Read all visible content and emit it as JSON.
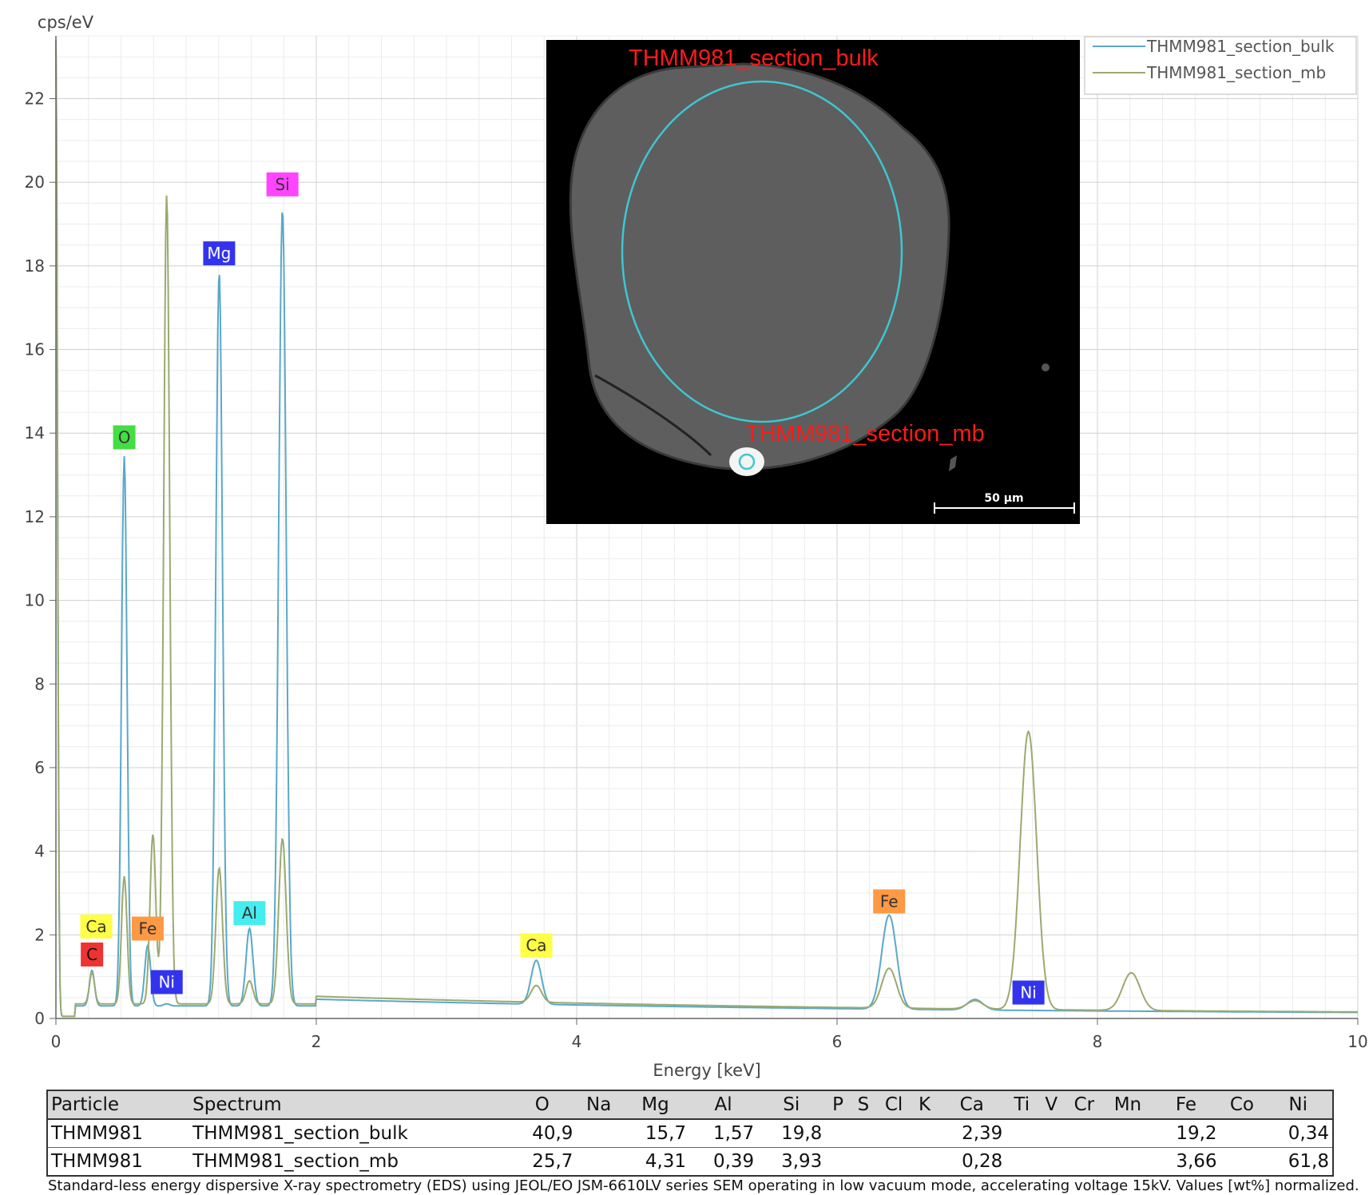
{
  "chart_data": {
    "type": "line",
    "ylabel": "cps/eV",
    "xlabel": "Energy [keV]",
    "xlim": [
      0,
      10
    ],
    "ylim": [
      0,
      23.5
    ],
    "xticks": [
      0,
      2,
      4,
      6,
      8,
      10
    ],
    "yticks": [
      0,
      2,
      4,
      6,
      8,
      10,
      12,
      14,
      16,
      18,
      20,
      22
    ],
    "grid": true,
    "legend_position": "top-right",
    "series": [
      {
        "name": "THMM981_section_bulk",
        "color": "#5aa8c8",
        "peaks": [
          {
            "x": 0.0,
            "y": 23.5
          },
          {
            "x": 0.277,
            "y": 1.0
          },
          {
            "x": 0.525,
            "y": 13.3
          },
          {
            "x": 0.705,
            "y": 1.6
          },
          {
            "x": 0.851,
            "y": 0.2
          },
          {
            "x": 1.254,
            "y": 17.7
          },
          {
            "x": 1.487,
            "y": 2.0
          },
          {
            "x": 1.74,
            "y": 19.2
          },
          {
            "x": 3.69,
            "y": 1.2
          },
          {
            "x": 6.4,
            "y": 2.4
          },
          {
            "x": 7.06,
            "y": 0.4
          },
          {
            "x": 7.47,
            "y": 0.15
          }
        ]
      },
      {
        "name": "THMM981_section_mb",
        "color": "#9aaa70",
        "peaks": [
          {
            "x": 0.0,
            "y": 23.5
          },
          {
            "x": 0.277,
            "y": 0.9
          },
          {
            "x": 0.525,
            "y": 3.2
          },
          {
            "x": 0.745,
            "y": 4.2
          },
          {
            "x": 0.851,
            "y": 19.5
          },
          {
            "x": 1.254,
            "y": 3.4
          },
          {
            "x": 1.487,
            "y": 0.7
          },
          {
            "x": 1.74,
            "y": 4.1
          },
          {
            "x": 3.69,
            "y": 0.55
          },
          {
            "x": 6.4,
            "y": 1.1
          },
          {
            "x": 7.06,
            "y": 0.35
          },
          {
            "x": 7.47,
            "y": 6.8
          },
          {
            "x": 8.26,
            "y": 1.05
          }
        ]
      }
    ],
    "element_labels": [
      {
        "text": "C",
        "x": 0.277,
        "y": 1.53,
        "bg": "#ee3333",
        "fg": "#111111"
      },
      {
        "text": "Ca",
        "x": 0.31,
        "y": 2.2,
        "bg": "#ffff44",
        "fg": "#333333"
      },
      {
        "text": "O",
        "x": 0.525,
        "y": 13.9,
        "bg": "#44dd44",
        "fg": "#333333"
      },
      {
        "text": "Fe",
        "x": 0.705,
        "y": 2.15,
        "bg": "#ff9944",
        "fg": "#333333"
      },
      {
        "text": "Ni",
        "x": 0.851,
        "y": 0.87,
        "bg": "#3333ee",
        "fg": "#ffffff"
      },
      {
        "text": "Mg",
        "x": 1.254,
        "y": 18.3,
        "bg": "#3333ee",
        "fg": "#ffffff"
      },
      {
        "text": "Al",
        "x": 1.487,
        "y": 2.52,
        "bg": "#44eeee",
        "fg": "#333333"
      },
      {
        "text": "Si",
        "x": 1.74,
        "y": 19.95,
        "bg": "#ff44ff",
        "fg": "#333333"
      },
      {
        "text": "Ca",
        "x": 3.69,
        "y": 1.75,
        "bg": "#ffff44",
        "fg": "#333333"
      },
      {
        "text": "Fe",
        "x": 6.4,
        "y": 2.8,
        "bg": "#ff9944",
        "fg": "#333333"
      },
      {
        "text": "Ni",
        "x": 7.47,
        "y": 0.62,
        "bg": "#3333ee",
        "fg": "#ffffff"
      }
    ]
  },
  "inset": {
    "label_bulk": "THMM981_section_bulk",
    "label_mb": "THMM981_section_mb",
    "scale_bar": "50 µm"
  },
  "table": {
    "headers": [
      "Particle",
      "Spectrum",
      "O",
      "Na",
      "Mg",
      "Al",
      "Si",
      "P",
      "S",
      "Cl",
      "K",
      "Ca",
      "Ti",
      "V",
      "Cr",
      "Mn",
      "Fe",
      "Co",
      "Ni"
    ],
    "rows": [
      [
        "THMM981",
        "THMM981_section_bulk",
        "40,9",
        "",
        "15,7",
        "1,57",
        "19,8",
        "",
        "",
        "",
        "",
        "2,39",
        "",
        "",
        "",
        "",
        "19,2",
        "",
        "0,34"
      ],
      [
        "THMM981",
        "THMM981_section_mb",
        "25,7",
        "",
        "4,31",
        "0,39",
        "3,93",
        "",
        "",
        "",
        "",
        "0,28",
        "",
        "",
        "",
        "",
        "3,66",
        "",
        "61,8"
      ]
    ]
  },
  "caption": "Standard-less energy dispersive X-ray spectrometry (EDS) using JEOL/EO JSM-6610LV series SEM operating in low vacuum mode, accelerating voltage 15kV. Values [wt%] normalized."
}
